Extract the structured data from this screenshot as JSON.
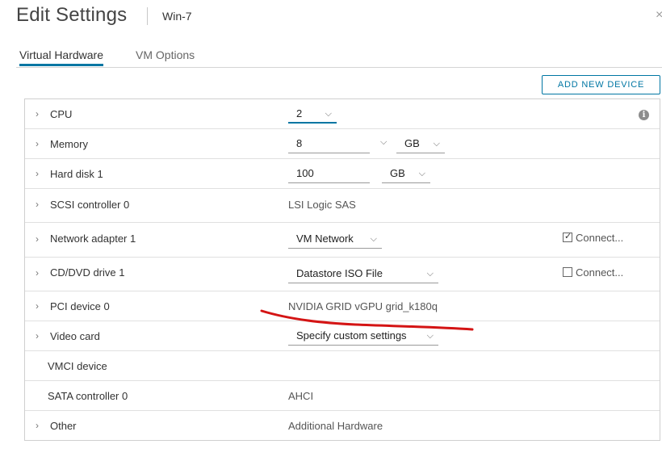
{
  "header": {
    "title": "Edit Settings",
    "vm_name": "Win-7",
    "close_glyph": "×"
  },
  "tabs": [
    {
      "label": "Virtual Hardware",
      "active": true
    },
    {
      "label": "VM Options",
      "active": false
    }
  ],
  "add_device_label": "ADD NEW DEVICE",
  "rows": {
    "cpu": {
      "label": "CPU",
      "value": "2"
    },
    "memory": {
      "label": "Memory",
      "value": "8",
      "unit": "GB"
    },
    "hard_disk": {
      "label": "Hard disk 1",
      "value": "100",
      "unit": "GB"
    },
    "scsi": {
      "label": "SCSI controller 0",
      "value": "LSI Logic SAS"
    },
    "network": {
      "label": "Network adapter 1",
      "value": "VM Network",
      "connect_label": "Connect...",
      "connected": true
    },
    "cdrom": {
      "label": "CD/DVD drive 1",
      "value": "Datastore ISO File",
      "connect_label": "Connect...",
      "connected": false
    },
    "pci": {
      "label": "PCI device 0",
      "value": "NVIDIA GRID vGPU grid_k180q"
    },
    "video": {
      "label": "Video card",
      "value": "Specify custom settings"
    },
    "vmci": {
      "label": "VMCI device"
    },
    "sata": {
      "label": "SATA controller 0",
      "value": "AHCI"
    },
    "other": {
      "label": "Other",
      "value": "Additional Hardware"
    }
  },
  "icons": {
    "chevron_right": "›",
    "chevron_down": "⌵",
    "info": "i",
    "check": "✓"
  },
  "colors": {
    "accent": "#0076a3",
    "annotation": "#d41414"
  }
}
